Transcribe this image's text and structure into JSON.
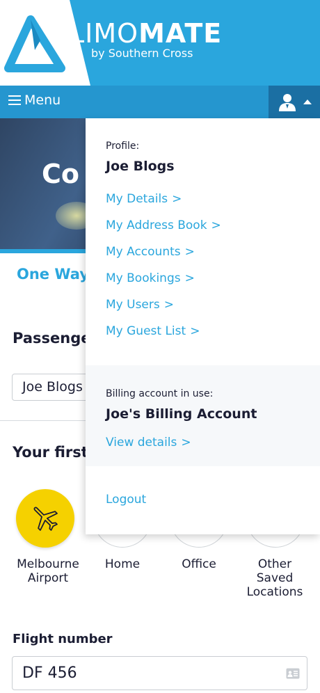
{
  "brand": {
    "name_light": "LIMO",
    "name_bold": "MATE",
    "subtitle": "by Southern Cross"
  },
  "menubar": {
    "menu_label": "Menu"
  },
  "hero": {
    "title_partial": "Co"
  },
  "trip": {
    "tab_label": "One Way"
  },
  "passenger": {
    "label": "Passenge",
    "value": "Joe Blogs"
  },
  "first_stop": {
    "label": "Your first"
  },
  "locations": [
    {
      "label_line1": "Melbourne",
      "label_line2": "Airport",
      "label_line3": "",
      "icon": "airplane-icon",
      "active": true
    },
    {
      "label_line1": "Home",
      "label_line2": "",
      "label_line3": "",
      "icon": "",
      "active": false
    },
    {
      "label_line1": "Office",
      "label_line2": "",
      "label_line3": "",
      "icon": "",
      "active": false
    },
    {
      "label_line1": "Other",
      "label_line2": "Saved",
      "label_line3": "Locations",
      "icon": "",
      "active": false
    }
  ],
  "flight": {
    "label": "Flight number",
    "value": "DF 456"
  },
  "dropdown": {
    "profile_heading": "Profile:",
    "profile_name": "Joe Blogs",
    "links": [
      "My Details",
      "My Address Book",
      "My Accounts",
      "My Bookings",
      "My Users",
      "My Guest List"
    ],
    "chevron": ">",
    "billing_heading": "Billing account in use:",
    "billing_name": "Joe's Billing Account",
    "view_details": "View details",
    "logout": "Logout"
  },
  "colors": {
    "primary": "#2aa6dd",
    "menubar": "#2596cf",
    "profile_button": "#1b6fa3",
    "accent_yellow": "#f5d100",
    "text": "#1b1d33"
  }
}
